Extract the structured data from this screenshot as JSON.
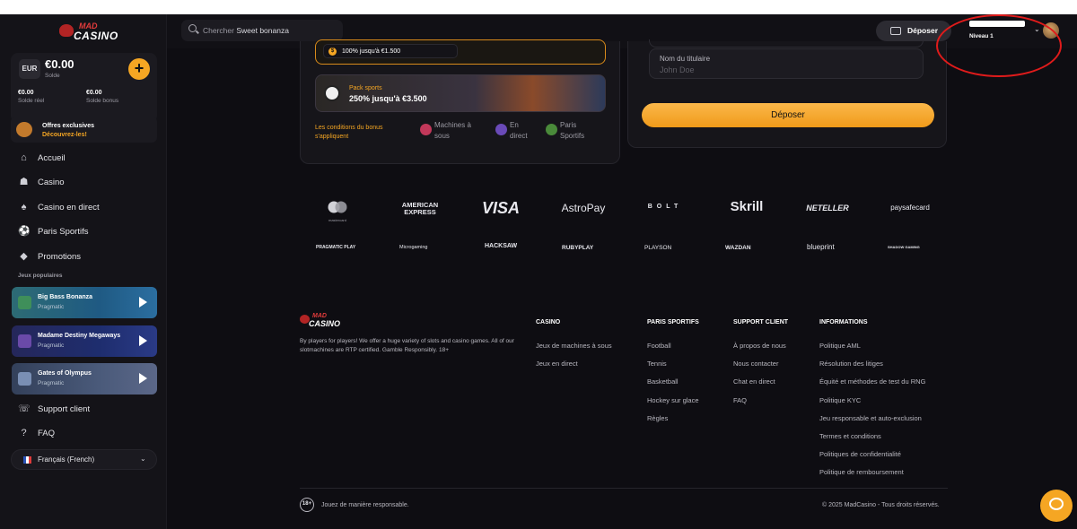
{
  "brand": {
    "logo_top": "MAD",
    "logo_bottom": "CASINO"
  },
  "balance": {
    "currency": "EUR",
    "amount": "€0.00",
    "label": "Solde",
    "real_amount": "€0.00",
    "real_label": "Solde réel",
    "bonus_amount": "€0.00",
    "bonus_label": "Solde bonus",
    "add_symbol": "+"
  },
  "offers": {
    "title": "Offres exclusives",
    "cta": "Découvrez-les!"
  },
  "nav": [
    {
      "label": "Accueil",
      "icon": "home-icon",
      "glyph": "⌂"
    },
    {
      "label": "Casino",
      "icon": "casino-icon",
      "glyph": "☗"
    },
    {
      "label": "Casino en direct",
      "icon": "cards-icon",
      "glyph": "♠"
    },
    {
      "label": "Paris Sportifs",
      "icon": "football-icon",
      "glyph": "⚽"
    },
    {
      "label": "Promotions",
      "icon": "diamond-icon",
      "glyph": "◆"
    }
  ],
  "popular_label": "Jeux populaires",
  "games": [
    {
      "name": "Big Bass Bonanza",
      "provider": "Pragmatic"
    },
    {
      "name": "Madame Destiny Megaways",
      "provider": "Pragmatic"
    },
    {
      "name": "Gates of Olympus",
      "provider": "Pragmatic"
    }
  ],
  "nav_bottom": [
    {
      "label": "Support client",
      "icon": "support-icon",
      "glyph": "☏"
    },
    {
      "label": "FAQ",
      "icon": "faq-icon",
      "glyph": "?"
    }
  ],
  "language": "Français (French)",
  "search": {
    "prefix": "Chercher",
    "suggestion": "Sweet bonanza"
  },
  "topbar": {
    "deposit_label": "Déposer",
    "level": "Niveau 1"
  },
  "bonus": {
    "first_pill": "100% jusqu'à €1.500",
    "sports_title": "Pack sports",
    "sports_offer": "250% jusqu'à €3.500",
    "conditions": "Les conditions du bonus s'appliquent",
    "categories": [
      "Machines à sous",
      "En direct",
      "Paris Sportifs"
    ]
  },
  "deposit_form": {
    "holder_label": "Nom du titulaire",
    "holder_placeholder": "John Doe",
    "submit": "Déposer"
  },
  "payments": [
    "mastercard",
    "AMERICAN EXPRESS",
    "VISA",
    "AstroPay",
    "BOLT",
    "Skrill",
    "NETELLER",
    "paysafecard"
  ],
  "providers": [
    "PRAGMATIC PLAY",
    "Microgaming",
    "HACKSAW",
    "RUBYPLAY",
    "PLAYSON",
    "WAZDAN",
    "blueprint",
    "SHADOW GAMING"
  ],
  "footer": {
    "description": "By players for players! We offer a huge variety of slots and casino games. All of our slotmachines are RTP certified. Gamble Responsibly. 18+",
    "columns": [
      {
        "title": "CASINO",
        "items": [
          "Jeux de machines à sous",
          "Jeux en direct"
        ]
      },
      {
        "title": "PARIS SPORTIFS",
        "items": [
          "Football",
          "Tennis",
          "Basketball",
          "Hockey sur glace",
          "Règles"
        ]
      },
      {
        "title": "SUPPORT CLIENT",
        "items": [
          "À propos de nous",
          "Nous contacter",
          "Chat en direct",
          "FAQ"
        ]
      },
      {
        "title": "INFORMATIONS",
        "items": [
          "Politique AML",
          "Résolution des litiges",
          "Équité et méthodes de test du RNG",
          "Politique KYC",
          "Jeu responsable et auto-exclusion",
          "Termes et conditions",
          "Politiques de confidentialité",
          "Politique de remboursement"
        ]
      }
    ],
    "age_badge": "18+",
    "responsible": "Jouez de manière responsable.",
    "copyright": "© 2025 MadCasino - Tous droits réservés."
  },
  "colors": {
    "accent": "#f5a623",
    "background": "#0e0d12",
    "annotation": "#e01b1b"
  }
}
